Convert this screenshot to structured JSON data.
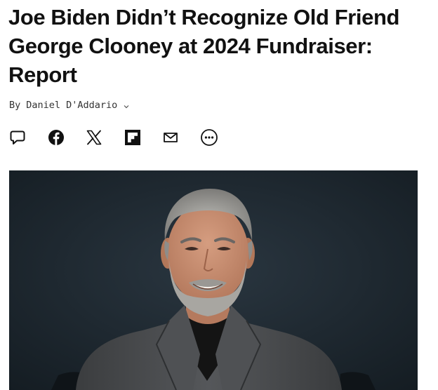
{
  "article": {
    "headline": "Joe Biden Didn’t Recognize Old Friend George Clooney at 2024 Fundraiser: Report",
    "byline": {
      "prefix": "By",
      "author": "Daniel D'Addario"
    }
  },
  "share_bar": {
    "buttons": [
      {
        "icon": "comment-icon"
      },
      {
        "icon": "facebook-icon"
      },
      {
        "icon": "x-icon"
      },
      {
        "icon": "flipboard-icon"
      },
      {
        "icon": "email-icon"
      },
      {
        "icon": "more-icon"
      }
    ]
  },
  "hero_image": {
    "subject": "photo",
    "colors": {
      "background": "#1f2a33",
      "jacket": "#4a4c4e",
      "shirt": "#141414",
      "hair": "#a9a9a5",
      "skin": "#c88f72"
    }
  }
}
